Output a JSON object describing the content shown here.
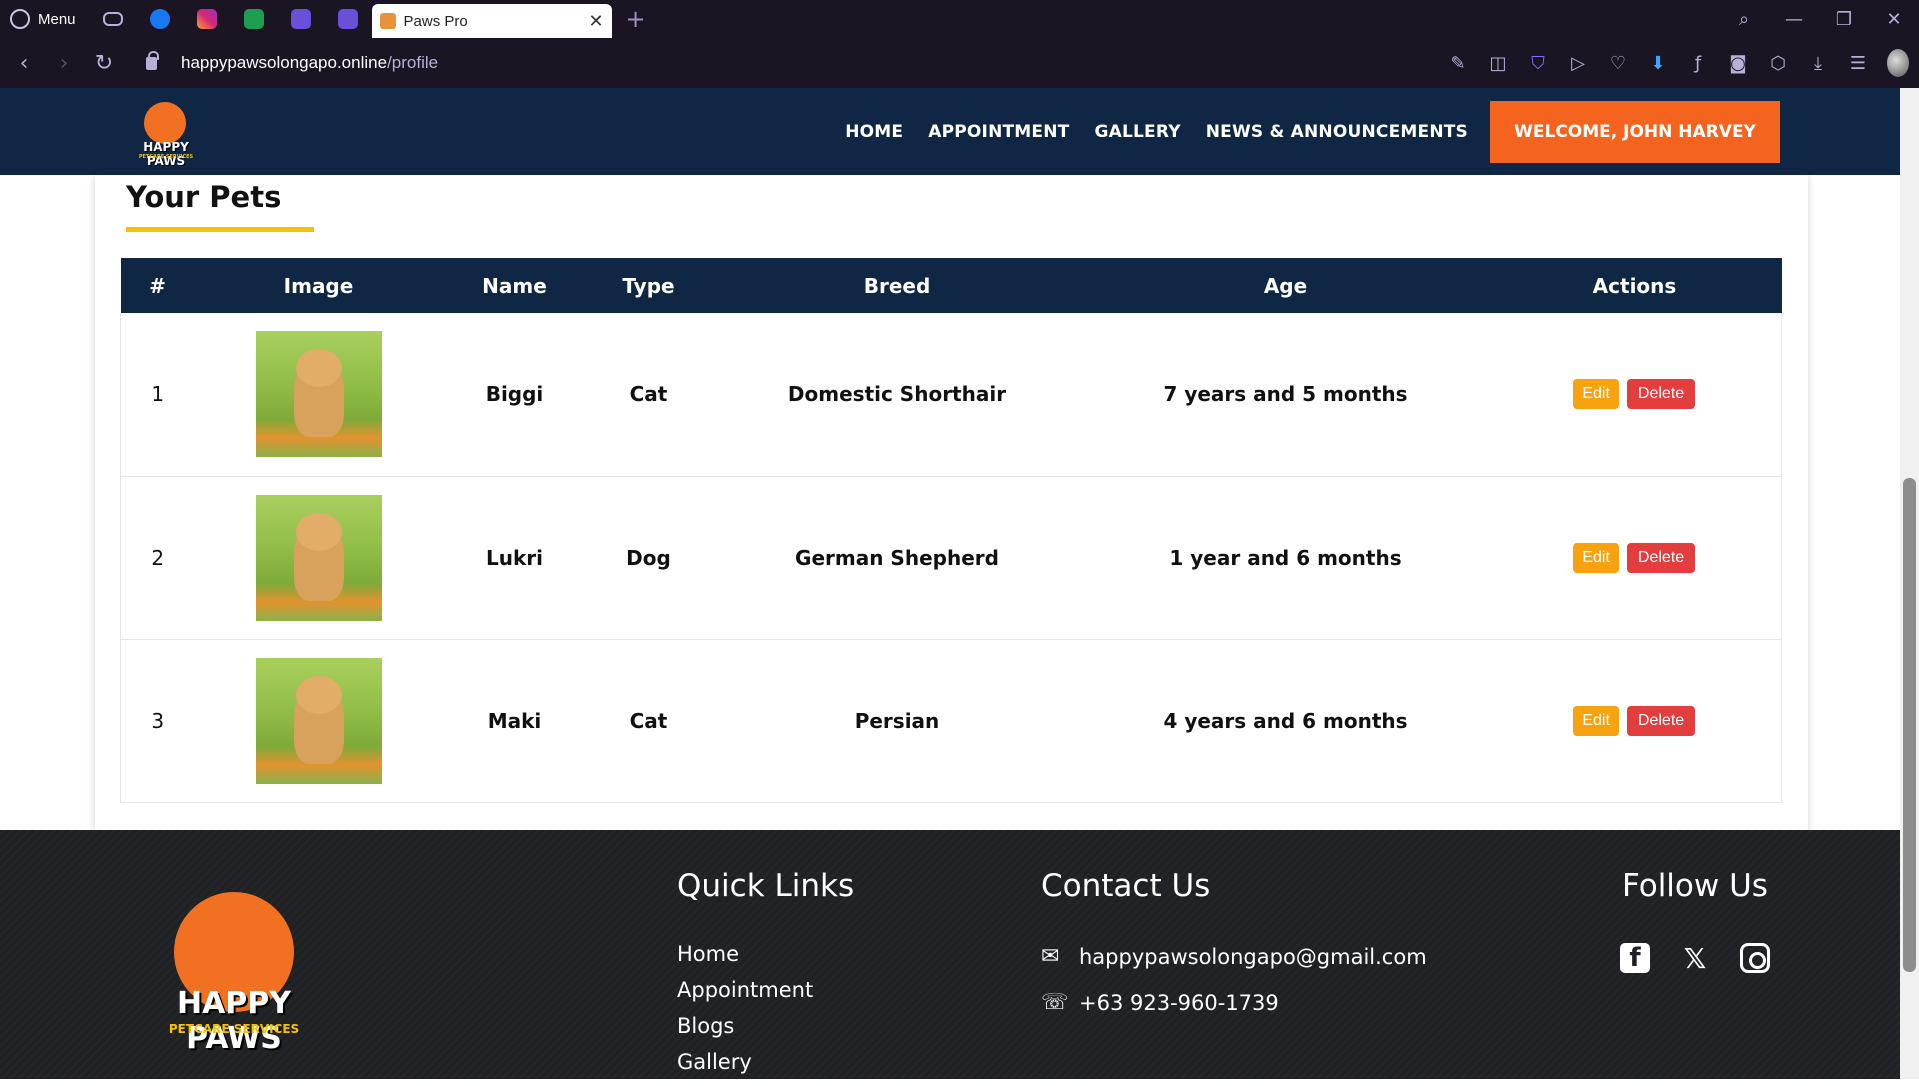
{
  "browser": {
    "menu_label": "Menu",
    "tab_title": "Paws Pro",
    "url_host": "happypawsolongapo.online",
    "url_path": "/profile",
    "pinned_icons": [
      "discord-icon",
      "facebook-icon",
      "instagram-icon",
      "sheets-icon",
      "tasks-icon",
      "tasks-icon"
    ]
  },
  "site": {
    "logo_text": "HAPPY PAWS",
    "logo_sub": "PETCARE SERVICES",
    "nav": [
      "HOME",
      "APPOINTMENT",
      "GALLERY",
      "NEWS & ANNOUNCEMENTS"
    ],
    "welcome": "WELCOME, JOHN HARVEY"
  },
  "pets": {
    "title": "Your Pets",
    "headers": [
      "#",
      "Image",
      "Name",
      "Type",
      "Breed",
      "Age",
      "Actions"
    ],
    "rows": [
      {
        "num": "1",
        "name": "Biggi",
        "type": "Cat",
        "breed": "Domestic Shorthair",
        "age": "7 years and 5 months"
      },
      {
        "num": "2",
        "name": "Lukri",
        "type": "Dog",
        "breed": "German Shepherd",
        "age": "1 year and 6 months"
      },
      {
        "num": "3",
        "name": "Maki",
        "type": "Cat",
        "breed": "Persian",
        "age": "4 years and 6 months"
      }
    ],
    "edit_label": "Edit",
    "delete_label": "Delete"
  },
  "footer": {
    "quick_links_title": "Quick Links",
    "quick_links": [
      "Home",
      "Appointment",
      "Blogs",
      "Gallery"
    ],
    "contact_title": "Contact Us",
    "email": "happypawsolongapo@gmail.com",
    "phone": "+63 923-960-1739",
    "follow_title": "Follow Us",
    "social_icons": [
      "facebook-icon",
      "x-icon",
      "instagram-icon"
    ]
  },
  "colors": {
    "navy": "#0f2744",
    "orange": "#f4641f",
    "yellow": "#f6c200",
    "edit": "#f7a30f",
    "delete": "#e33d3d"
  }
}
